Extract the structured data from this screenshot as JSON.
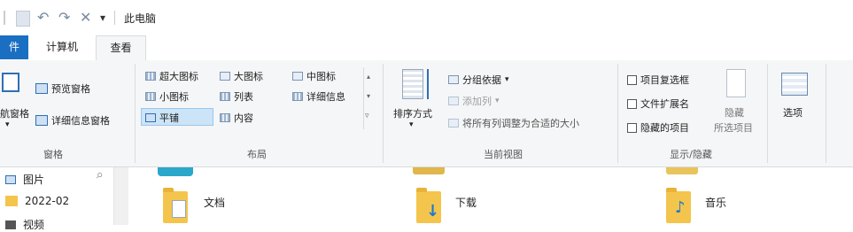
{
  "window": {
    "title": "此电脑"
  },
  "quick_access": {
    "undo": "↶",
    "redo": "↷",
    "delete": "✕",
    "dropdown": "▾"
  },
  "tabs": [
    {
      "label": "件"
    },
    {
      "label": "计算机"
    },
    {
      "label": "查看"
    }
  ],
  "ribbon": {
    "panes": {
      "label": "窗格",
      "nav_pane_label": "航窗格",
      "preview_pane": "预览窗格",
      "details_pane": "详细信息窗格"
    },
    "layout": {
      "label": "布局",
      "items": [
        "超大图标",
        "大图标",
        "中图标",
        "小图标",
        "列表",
        "详细信息",
        "平铺",
        "内容"
      ],
      "selected": "平铺"
    },
    "current_view": {
      "label": "当前视图",
      "sort_by": "排序方式",
      "group_by": "分组依据",
      "add_columns": "添加列",
      "size_columns": "将所有列调整为合适的大小"
    },
    "show_hide": {
      "label": "显示/隐藏",
      "item_checkboxes": "项目复选框",
      "file_extensions": "文件扩展名",
      "hidden_items": "隐藏的项目",
      "hide_selected": "隐藏",
      "hide_selected_sub": "所选项目"
    },
    "options": {
      "label": "选项"
    }
  },
  "nav": {
    "items": [
      "图片",
      "2022-02",
      "视频"
    ],
    "pin": "📌"
  },
  "content": {
    "folders": [
      "文档",
      "下载",
      "音乐"
    ]
  }
}
